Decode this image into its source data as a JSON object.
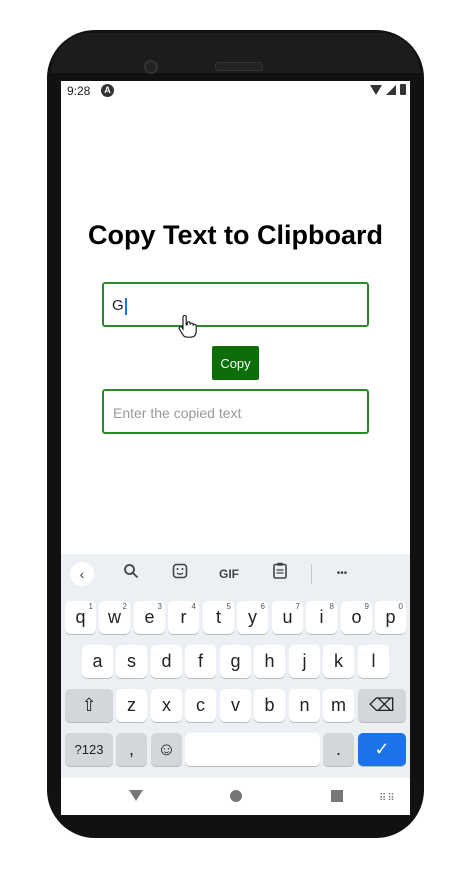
{
  "status_bar": {
    "time": "9:28",
    "notification_glyph": "A"
  },
  "app": {
    "title": "Copy Text to Clipboard",
    "input_value": "G",
    "copy_button_label": "Copy",
    "paste_input_placeholder": "Enter the copied text"
  },
  "keyboard": {
    "toolbar": {
      "back_glyph": "‹",
      "search_glyph": "⚲",
      "sticker_glyph": "☺",
      "gif_label": "GIF",
      "clipboard_glyph": "📋",
      "more_glyph": "•••"
    },
    "row1": [
      {
        "key": "q",
        "hint": "1"
      },
      {
        "key": "w",
        "hint": "2"
      },
      {
        "key": "e",
        "hint": "3"
      },
      {
        "key": "r",
        "hint": "4"
      },
      {
        "key": "t",
        "hint": "5"
      },
      {
        "key": "y",
        "hint": "6"
      },
      {
        "key": "u",
        "hint": "7"
      },
      {
        "key": "i",
        "hint": "8"
      },
      {
        "key": "o",
        "hint": "9"
      },
      {
        "key": "p",
        "hint": "0"
      }
    ],
    "row2": [
      "a",
      "s",
      "d",
      "f",
      "g",
      "h",
      "j",
      "k",
      "l"
    ],
    "row3": [
      "z",
      "x",
      "c",
      "v",
      "b",
      "n",
      "m"
    ],
    "shift_glyph": "⇧",
    "backspace_glyph": "⌫",
    "symbols_label": "?123",
    "comma_label": ",",
    "emoji_glyph": "☺",
    "period_label": ".",
    "enter_glyph": "✓"
  },
  "nav_bar": {
    "keyboard_switch_glyph": "⠿⠿"
  }
}
